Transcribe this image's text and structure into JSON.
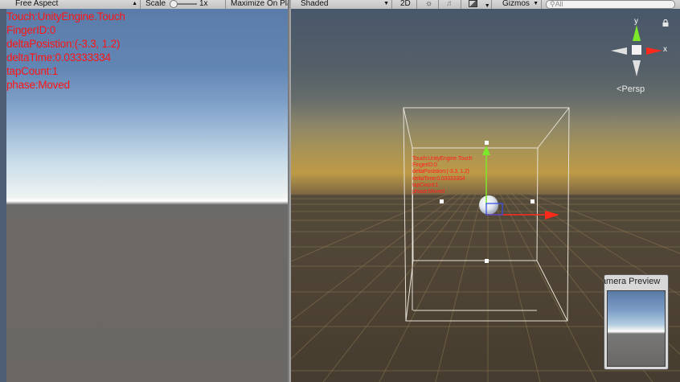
{
  "game_view": {
    "toolbar": {
      "aspect_label": "Free Aspect",
      "scale_label": "Scale",
      "scale_value": "1x",
      "maximize_label": "Maximize On Play"
    },
    "touch_info": [
      "Touch:UnityEngine.Touch",
      "FingerID:0",
      "deltaPosistion:(-3.3, 1.2)",
      "deltaTime:0.03333334",
      "tapCount:1",
      "phase:Moved"
    ]
  },
  "scene_view": {
    "toolbar": {
      "draw_mode": "Shaded",
      "mode_2d": "2D",
      "lighting_icon": "sun-icon",
      "audio_icon": "speaker-icon",
      "effects_icon": "image-icon",
      "gizmos_label": "Gizmos",
      "search_placeholder": "All"
    },
    "gizmo": {
      "y_label": "y",
      "x_label": "x",
      "projection_label": "Persp"
    },
    "camera_preview": {
      "title": "Camera Preview"
    }
  },
  "colors": {
    "touch_text": "#ff1515",
    "axis_x": "#ff2a1a",
    "axis_y": "#7ce82a",
    "axis_z": "#3a50e0"
  }
}
